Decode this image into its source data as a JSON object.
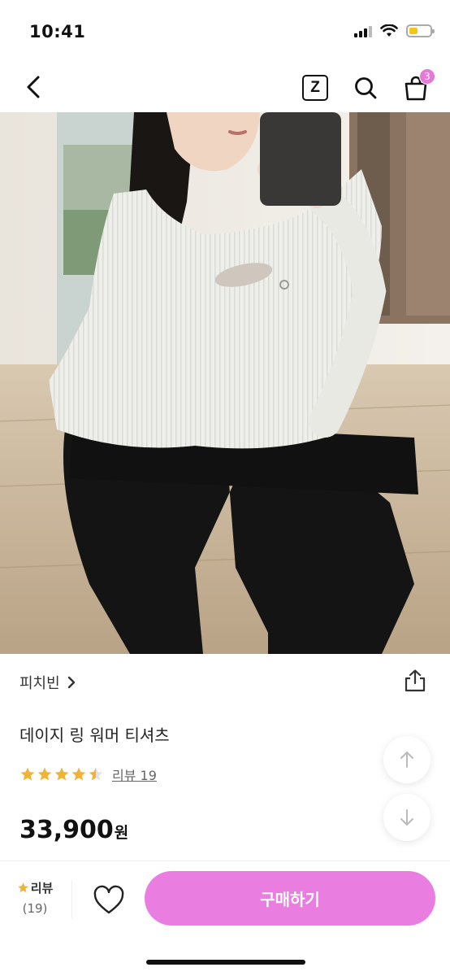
{
  "status_bar": {
    "time": "10:41",
    "battery_level": 0.4,
    "battery_color": "#f5c518"
  },
  "nav": {
    "back_icon": "chevron-left-icon",
    "z_label": "Z",
    "search_icon": "search-icon",
    "cart_icon": "shopping-bag-icon",
    "cart_count": "3"
  },
  "product": {
    "image_alt": "white ribbed knit long-sleeve top with ring cutout",
    "store_name": "피치빈",
    "title": "데이지 링 워머 티셔츠",
    "rating": 4.5,
    "review_label": "리뷰 19",
    "price": "33,900",
    "price_unit": "원"
  },
  "bottom_bar": {
    "review_label": "리뷰",
    "review_count": "(19)",
    "buy_label": "구매하기",
    "accent_color": "#ea7ee0"
  }
}
